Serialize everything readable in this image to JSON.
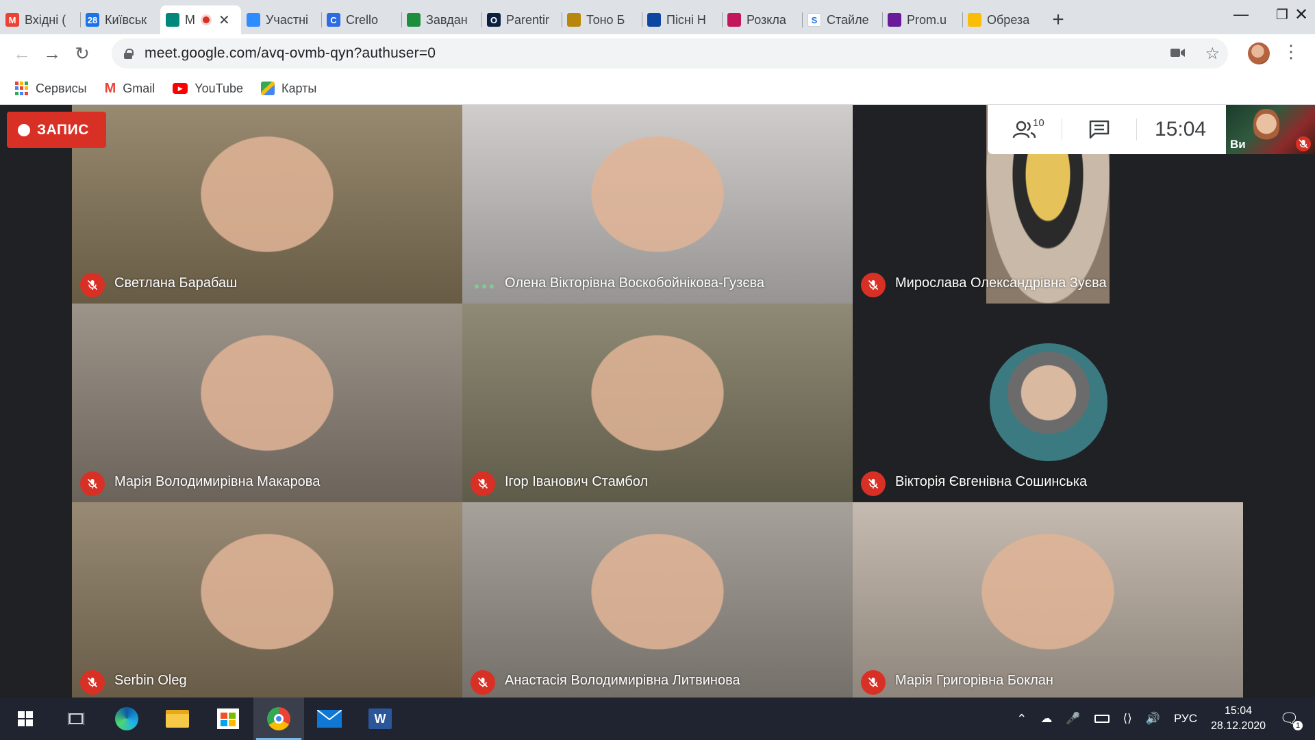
{
  "tabs": [
    {
      "title": "Вхідні (",
      "icon": "gmail-icon",
      "color": "#ea4335",
      "letter": "M"
    },
    {
      "title": "Київськ",
      "icon": "calendar-icon",
      "color": "#1a73e8",
      "letter": "28"
    },
    {
      "title": "M",
      "icon": "meet-icon",
      "color": "#00897b",
      "letter": "",
      "active": true
    },
    {
      "title": "Участні",
      "icon": "zoom-icon",
      "color": "#2d8cff",
      "letter": ""
    },
    {
      "title": "Crello",
      "icon": "crello-icon",
      "color": "#2d6be4",
      "letter": "C"
    },
    {
      "title": "Завдан",
      "icon": "classroom-icon",
      "color": "#1e8e3e",
      "letter": ""
    },
    {
      "title": "Parentir",
      "icon": "parenting-icon",
      "color": "#0b1f3f",
      "letter": "O"
    },
    {
      "title": "Тоно Б",
      "icon": "tono-icon",
      "color": "#b8860b",
      "letter": ""
    },
    {
      "title": "Пісні Н",
      "icon": "songs-icon",
      "color": "#0d47a1",
      "letter": ""
    },
    {
      "title": "Розкла",
      "icon": "schedule-icon",
      "color": "#c2185b",
      "letter": ""
    },
    {
      "title": "Стайле",
      "icon": "styler-icon",
      "color": "#ffffff",
      "letter": "S"
    },
    {
      "title": "Prom.u",
      "icon": "prom-icon",
      "color": "#6a1b9a",
      "letter": ""
    },
    {
      "title": "Обреза",
      "icon": "crop-icon",
      "color": "#fbbc04",
      "letter": ""
    }
  ],
  "address": {
    "url": "meet.google.com/avq-ovmb-qyn?authuser=0"
  },
  "bookmarks": [
    {
      "label": "Сервисы",
      "icon": "apps-grid-icon"
    },
    {
      "label": "Gmail",
      "icon": "gmail-icon"
    },
    {
      "label": "YouTube",
      "icon": "youtube-icon"
    },
    {
      "label": "Карты",
      "icon": "maps-icon"
    }
  ],
  "meet": {
    "recording_label": "ЗАПИС",
    "participants_count": "10",
    "clock": "15:04",
    "self_label": "Ви",
    "participants": [
      {
        "name": "Светлана Барабаш",
        "muted": true,
        "bg": "#8a7a5c"
      },
      {
        "name": "Олена Вікторівна Воскобойнікова-Гузєва",
        "muted": false,
        "bg": "#c9c6c4"
      },
      {
        "name": "Мирослава Олександрівна Зуєва",
        "muted": true,
        "bg": "#202124"
      },
      {
        "name": "Марія Володимирівна Макарова",
        "muted": true,
        "bg": "#8f8579"
      },
      {
        "name": "Ігор Іванович Стамбол",
        "muted": true,
        "bg": "#7f7a62"
      },
      {
        "name": "Вікторія Євгенівна Сошинська",
        "muted": true,
        "bg": "#202124"
      },
      {
        "name": "Serbin Oleg",
        "muted": true,
        "bg": "#8a7a60"
      },
      {
        "name": "Анастасія Володимирівна Литвинова",
        "muted": true,
        "bg": "#9a948c"
      },
      {
        "name": "Марія Григорівна Боклан",
        "muted": true,
        "bg": "#bdb1a5"
      }
    ]
  },
  "taskbar": {
    "apps": [
      "windows-start-icon",
      "task-view-icon",
      "edge-icon",
      "file-explorer-icon",
      "store-icon",
      "chrome-icon",
      "mail-icon",
      "word-icon"
    ],
    "language": "РУС",
    "time": "15:04",
    "date": "28.12.2020",
    "notification_count": "1"
  }
}
